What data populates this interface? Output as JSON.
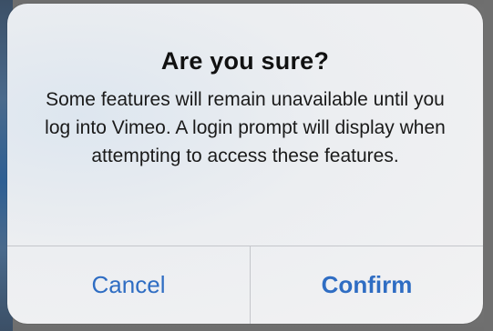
{
  "alert": {
    "title": "Are you sure?",
    "message": "Some features will remain unavailable until you log into Vimeo. A login prompt will display when attempting to access these features.",
    "buttons": {
      "cancel_label": "Cancel",
      "confirm_label": "Confirm"
    }
  },
  "colors": {
    "button_text": "#2f6dc3",
    "title_text": "#111111",
    "dialog_background": "#f0f1f3",
    "divider": "#c4c6cb"
  }
}
